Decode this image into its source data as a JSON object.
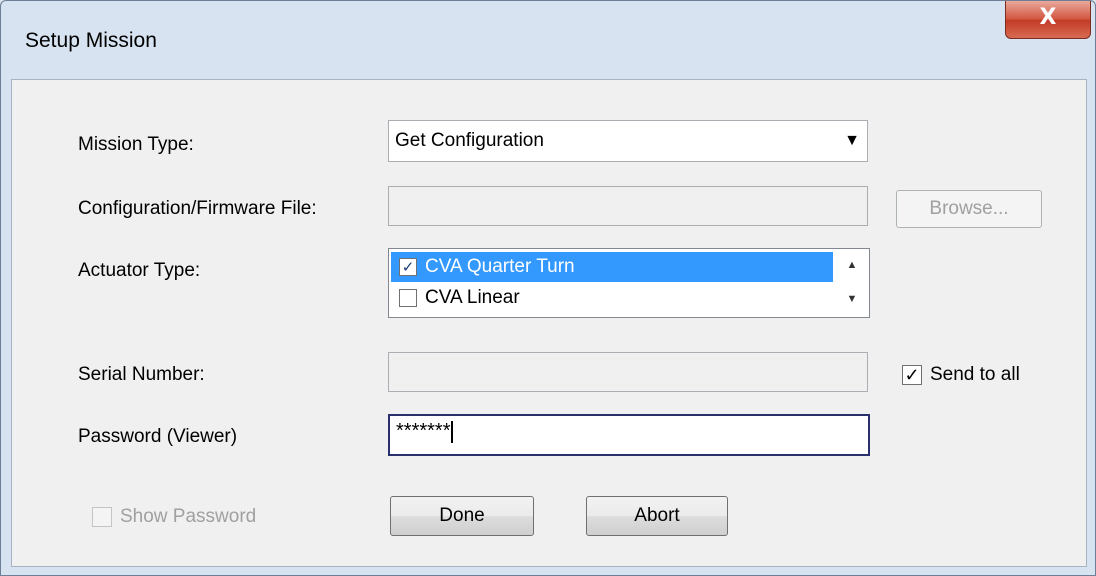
{
  "window": {
    "title": "Setup Mission",
    "close_glyph": "X"
  },
  "form": {
    "mission_type_label": "Mission Type:",
    "mission_type_value": "Get Configuration",
    "config_file_label": "Configuration/Firmware File:",
    "config_file_value": "",
    "browse_label": "Browse...",
    "actuator_type_label": "Actuator Type:",
    "actuator_items": [
      {
        "label": "CVA Quarter Turn",
        "checked": true,
        "selected": true
      },
      {
        "label": "CVA Linear",
        "checked": false,
        "selected": false
      }
    ],
    "serial_label": "Serial Number:",
    "serial_value": "",
    "send_to_all_label": "Send to all",
    "send_to_all_checked": true,
    "password_label": "Password (Viewer)",
    "password_value": "*******",
    "show_password_label": "Show Password",
    "show_password_checked": false
  },
  "buttons": {
    "done": "Done",
    "abort": "Abort"
  },
  "colors": {
    "selection": "#3399ff",
    "focus_border": "#29306b",
    "close_red": "#c23b26"
  },
  "icons": {
    "dropdown": "chevron-down-icon",
    "close": "close-icon",
    "check": "check-icon"
  }
}
